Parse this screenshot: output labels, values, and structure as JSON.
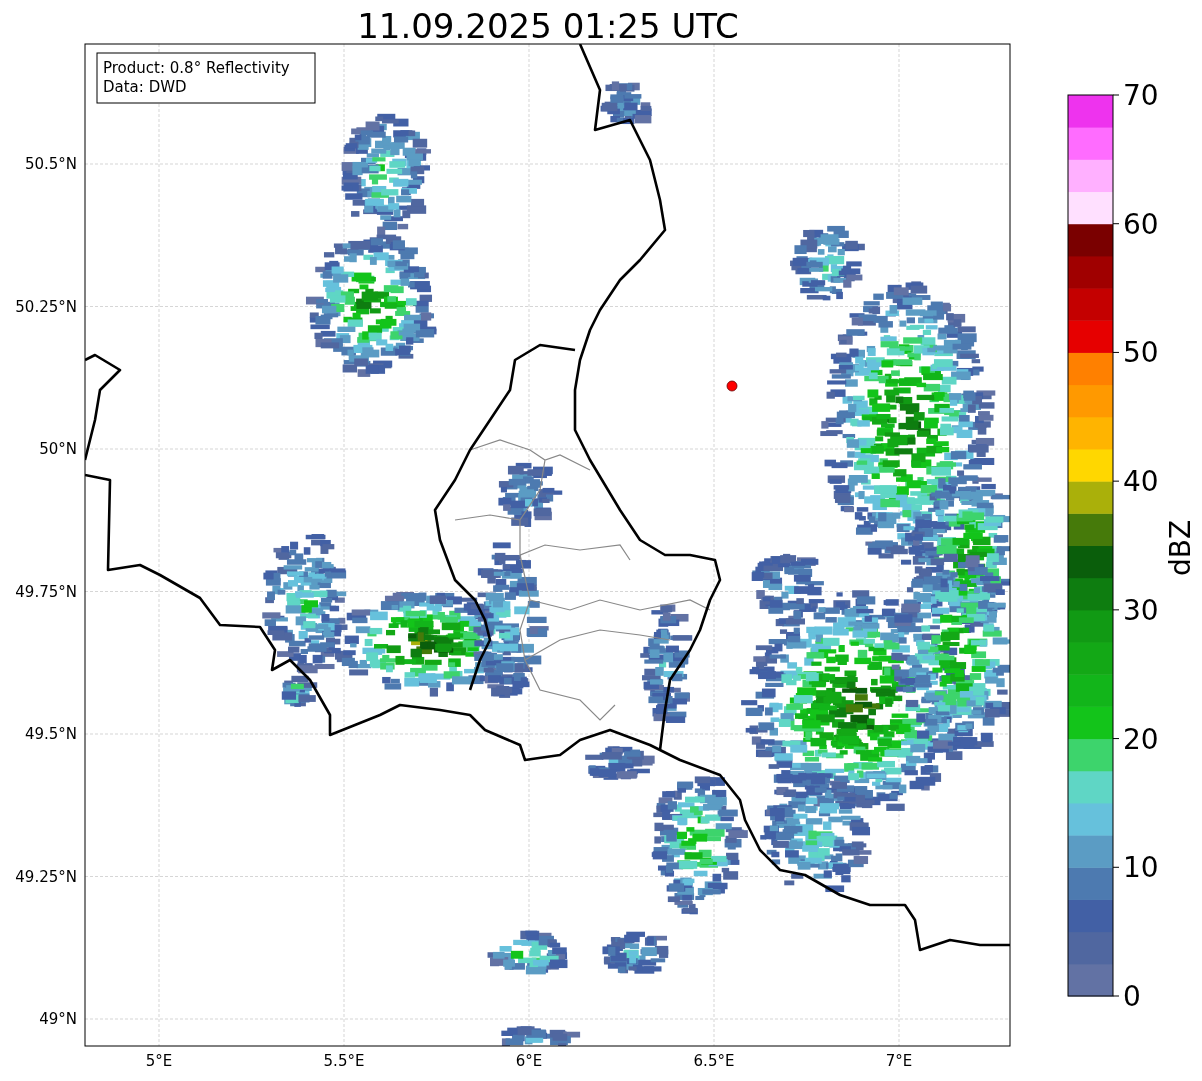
{
  "title": "11.09.2025 01:25 UTC",
  "info_box": [
    "Product: 0.8° Reflectivity",
    "Data: DWD"
  ],
  "map": {
    "x_ticks": [
      "5°E",
      "5.5°E",
      "6°E",
      "6.5°E",
      "7°E"
    ],
    "y_ticks": [
      "50.5°N",
      "50.25°N",
      "50°N",
      "49.75°N",
      "49.5°N",
      "49.25°N",
      "49°N"
    ]
  },
  "colorbar": {
    "label": "dBZ",
    "ticks": [
      "70",
      "60",
      "50",
      "40",
      "30",
      "20",
      "10",
      "0"
    ],
    "segments": [
      {
        "color": "#6272a4"
      },
      {
        "color": "#5067a0"
      },
      {
        "color": "#4260a5"
      },
      {
        "color": "#4d7ab0"
      },
      {
        "color": "#5b9cc4"
      },
      {
        "color": "#66c1dc"
      },
      {
        "color": "#5fd6c5"
      },
      {
        "color": "#3dd46c"
      },
      {
        "color": "#13c41a"
      },
      {
        "color": "#12b51a"
      },
      {
        "color": "#13a816"
      },
      {
        "color": "#119a14"
      },
      {
        "color": "#0e7d10"
      },
      {
        "color": "#0a5e0b"
      },
      {
        "color": "#467a0a"
      },
      {
        "color": "#aab00a"
      },
      {
        "color": "#ffd700"
      },
      {
        "color": "#ffb400"
      },
      {
        "color": "#ff9900"
      },
      {
        "color": "#ff8000"
      },
      {
        "color": "#e60000"
      },
      {
        "color": "#c40000"
      },
      {
        "color": "#a00000"
      },
      {
        "color": "#7a0000"
      },
      {
        "color": "#ffe0ff"
      },
      {
        "color": "#ffb0ff"
      },
      {
        "color": "#ff6cff"
      },
      {
        "color": "#ee33ee"
      }
    ]
  }
}
